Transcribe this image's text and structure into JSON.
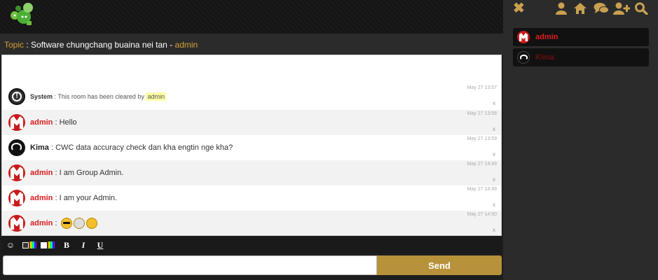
{
  "topic": {
    "label": "Topic",
    "sep": " : ",
    "title": "Software chungchang buaina nei tan",
    "dash": " - ",
    "owner": "admin"
  },
  "messages": [
    {
      "name": "System",
      "sep": " : ",
      "text": "This room has been cleared by ",
      "highlight": "admin",
      "time": "May 27 13:57",
      "delete": "x"
    },
    {
      "name": "admin",
      "sep": " : ",
      "text": "Hello",
      "time": "May 27 13:58",
      "delete": "x"
    },
    {
      "name": "Kima",
      "sep": " : ",
      "text": "CWC data accuracy check dan kha engtin nge kha?",
      "time": "May 27 13:59",
      "delete": "x"
    },
    {
      "name": "admin",
      "sep": " : ",
      "text": "I am Group Admin.",
      "time": "May 27 14:49",
      "delete": "x"
    },
    {
      "name": "admin",
      "sep": " : ",
      "text": "I am your Admin.",
      "time": "May 27 14:49",
      "delete": "x"
    },
    {
      "name": "admin",
      "sep": " : ",
      "time": "May 27 14:50",
      "delete": "x"
    }
  ],
  "toolbar": {
    "smiley": "☺",
    "bold": "B",
    "italic": "I",
    "underline": "U"
  },
  "input": {
    "value": "",
    "placeholder": ""
  },
  "send_label": "Send",
  "sidebar": {
    "icons": [
      "close-icon",
      "profile-icon",
      "home-icon",
      "rooms-icon",
      "add-user-icon",
      "search-icon"
    ],
    "users": [
      {
        "name": "admin",
        "color": "#e01e1e"
      },
      {
        "name": "Kima",
        "color": "#6a0d0d"
      }
    ]
  },
  "colors": {
    "accent": "#b8923a",
    "admin": "#d61c1c",
    "topic_label": "#d4a035"
  }
}
